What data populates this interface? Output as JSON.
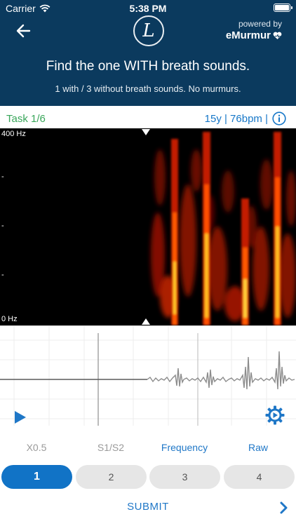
{
  "status": {
    "carrier": "Carrier",
    "time": "5:38 PM"
  },
  "header": {
    "logo_letter": "L",
    "powered_by": "powered by",
    "brand": "eMurmur",
    "title": "Find the one WITH breath sounds.",
    "subtitle": "1 with / 3 without breath sounds. No murmurs."
  },
  "info": {
    "task": "Task 1/6",
    "vitals": "15y | 76bpm |"
  },
  "spectrogram": {
    "top_label": "400 Hz",
    "tick1": "-",
    "tick2": "-",
    "tick3": "-",
    "bottom_label": "0 Hz"
  },
  "options": {
    "speed": "X0.5",
    "s1s2": "S1/S2",
    "frequency": "Frequency",
    "raw": "Raw"
  },
  "choices": [
    "1",
    "2",
    "3",
    "4"
  ],
  "selected_choice": "1",
  "submit_label": "SUBMIT",
  "colors": {
    "header_bg": "#0b3a5e",
    "accent": "#1173c6",
    "task_green": "#39a65a"
  }
}
